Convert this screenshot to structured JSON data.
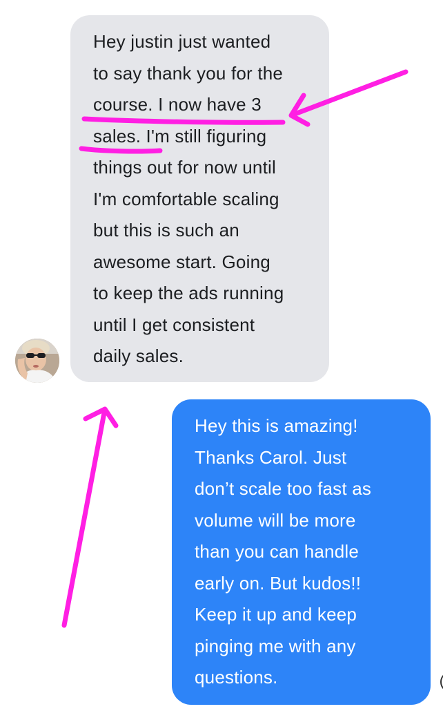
{
  "conversation": {
    "incoming": {
      "sender_avatar": "avatar-photo",
      "lines": [
        "Hey justin just wanted",
        "to say thank you for the",
        "course. I now have 3",
        "sales. I'm still figuring",
        "things out for now until",
        "I'm comfortable scaling",
        "but this is such an",
        "awesome start. Going",
        "to keep the ads running",
        "until I get consistent",
        "daily sales."
      ],
      "bubble_color": "#e5e6ea"
    },
    "outgoing": {
      "lines": [
        "Hey this is amazing!",
        "Thanks Carol. Just",
        "don’t scale too fast as",
        "volume will be more",
        "than you can handle",
        "early on. But kudos!!",
        "Keep it up and keep",
        "pinging me with any",
        "questions."
      ],
      "bubble_color": "#2d84f8"
    }
  },
  "annotations": {
    "color": "#ff1fe3",
    "marks": [
      "underline-course-3",
      "underline-sales",
      "arrow-to-underline",
      "arrow-to-incoming-bubble"
    ]
  }
}
